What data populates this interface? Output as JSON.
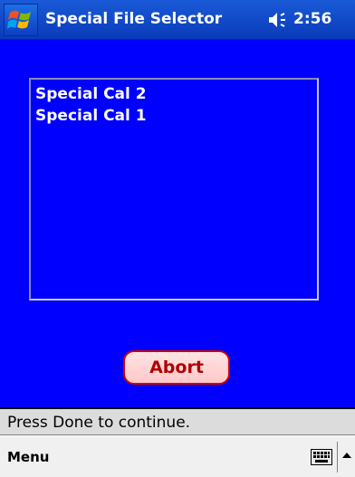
{
  "window": {
    "title": "Special File Selector",
    "time": "2:56",
    "start_icon": "windows-flag-icon",
    "volume_icon": "speaker-icon"
  },
  "file_list": {
    "items": [
      {
        "label": "Special Cal 2"
      },
      {
        "label": "Special Cal 1"
      }
    ]
  },
  "buttons": {
    "abort_label": "Abort"
  },
  "status": {
    "text": "Press Done to continue."
  },
  "menubar": {
    "menu_label": "Menu",
    "keyboard_icon": "keyboard-icon",
    "sip_arrow_icon": "up-arrow-icon"
  },
  "colors": {
    "background": "#0000ff",
    "titlebar": "#1a5ad8",
    "abort_border": "#cc0000",
    "abort_text": "#b00000"
  }
}
